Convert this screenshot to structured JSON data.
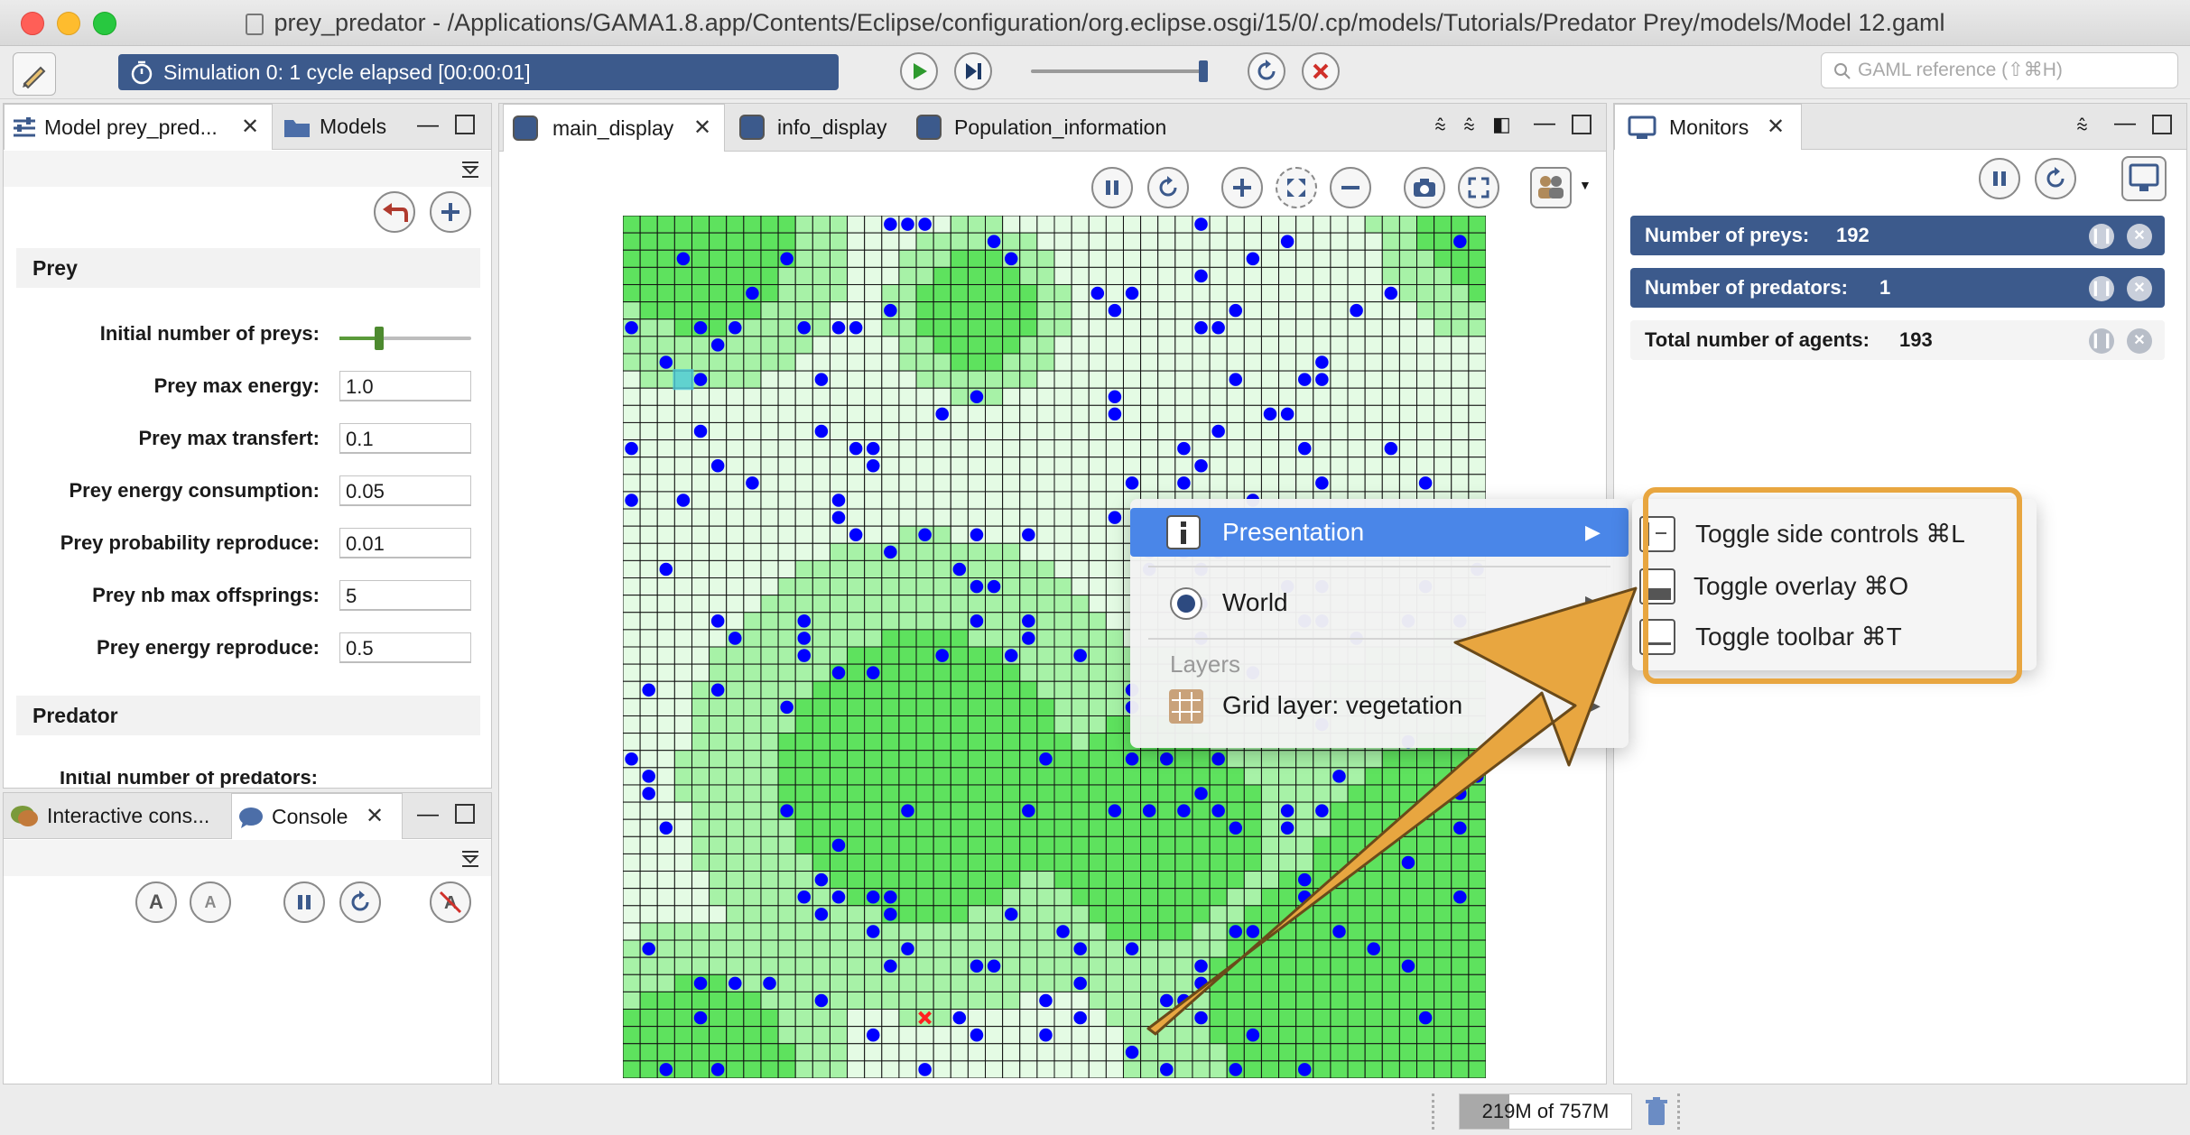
{
  "window": {
    "title": "prey_predator - /Applications/GAMA1.8.app/Contents/Eclipse/configuration/org.eclipse.osgi/15/0/.cp/models/Tutorials/Predator Prey/models/Model 12.gaml"
  },
  "toolbar": {
    "simulation_status": "Simulation 0: 1 cycle elapsed [00:00:01]",
    "search_placeholder": "GAML reference (⇧⌘H)",
    "play_icon": "play-icon",
    "step_icon": "step-icon",
    "reload_icon": "reload-icon",
    "close_icon": "close-icon"
  },
  "left_panel": {
    "tabs": [
      "Model prey_pred...",
      "Models"
    ],
    "sections": {
      "prey": "Prey",
      "predator": "Predator"
    },
    "prey_params": [
      {
        "label": "Initial number of preys:",
        "slider_fraction": 0.3
      },
      {
        "label": "Prey max energy:",
        "value": "1.0"
      },
      {
        "label": "Prey max transfert:",
        "value": "0.1"
      },
      {
        "label": "Prey energy consumption:",
        "value": "0.05"
      },
      {
        "label": "Prey probability reproduce:",
        "value": "0.01"
      },
      {
        "label": "Prey nb max offsprings:",
        "value": "5"
      },
      {
        "label": "Prey energy reproduce:",
        "value": "0.5"
      }
    ],
    "predator_partial_label": "Initial number of predators:"
  },
  "console_panel": {
    "tabs": [
      "Interactive cons...",
      "Console"
    ]
  },
  "display_panel": {
    "tabs": [
      "main_display",
      "info_display",
      "Population_information"
    ]
  },
  "monitors_panel": {
    "tab": "Monitors",
    "items": [
      {
        "label": "Number of preys:",
        "value": "192"
      },
      {
        "label": "Number of predators:",
        "value": "1"
      },
      {
        "label": "Total number of agents:",
        "value": "193"
      }
    ]
  },
  "context_menu": {
    "presentation": "Presentation",
    "world": "World",
    "layers_header": "Layers",
    "grid_layer": "Grid layer: vegetation"
  },
  "submenu": {
    "items": [
      "Toggle side controls ⌘L",
      "Toggle overlay ⌘O",
      "Toggle toolbar ⌘T"
    ]
  },
  "status_bar": {
    "memory": "219M of 757M",
    "memory_fraction": 0.289
  },
  "colors": {
    "accent_blue": "#3c5a8c",
    "menu_highlight": "#4a86e8",
    "grass_bright": "#5ee25e",
    "grass_medium": "#a7f2a7",
    "grass_pale": "#e4fbe4",
    "prey": "#0000ff",
    "predator": "#ff2020",
    "highlight_frame": "#e8a640"
  }
}
